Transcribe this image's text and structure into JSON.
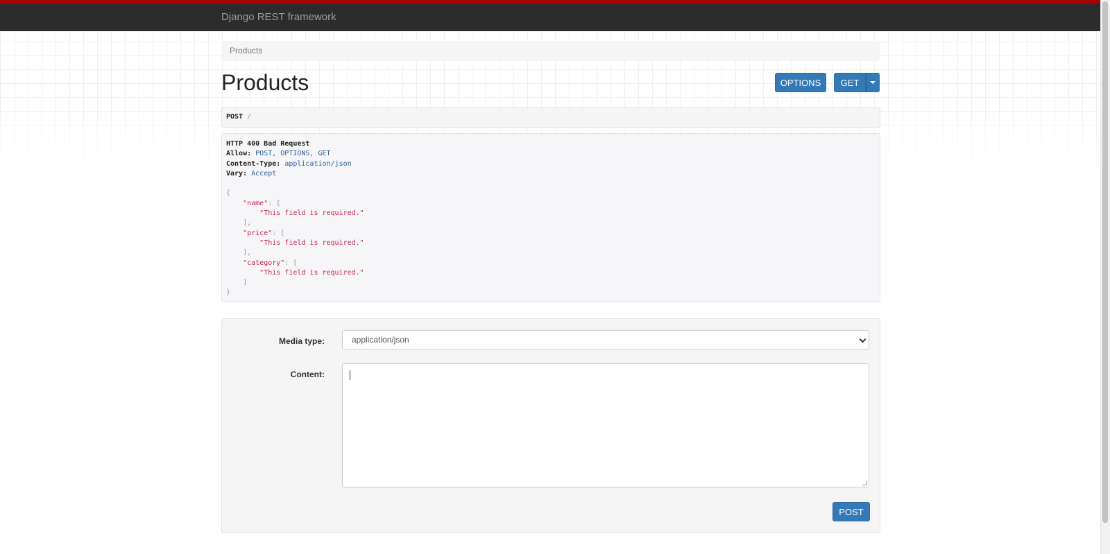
{
  "navbar": {
    "brand": "Django REST framework"
  },
  "breadcrumb": {
    "item": "Products"
  },
  "page": {
    "title": "Products"
  },
  "toolbar": {
    "options_label": "OPTIONS",
    "get_label": "GET"
  },
  "request": {
    "method": "POST",
    "path": "/"
  },
  "response": {
    "status": "HTTP 400 Bad Request",
    "headers": [
      {
        "key": "Allow:",
        "value": "POST, OPTIONS, GET"
      },
      {
        "key": "Content-Type:",
        "value": "application/json"
      },
      {
        "key": "Vary:",
        "value": "Accept"
      }
    ],
    "errors": [
      {
        "field": "\"name\"",
        "message": "\"This field is required.\""
      },
      {
        "field": "\"price\"",
        "message": "\"This field is required.\""
      },
      {
        "field": "\"category\"",
        "message": "\"This field is required.\""
      }
    ]
  },
  "form": {
    "media_type_label": "Media type:",
    "media_type_value": "application/json",
    "content_label": "Content:",
    "content_value": "",
    "submit_label": "POST"
  },
  "colors": {
    "accent": "#a30000",
    "navbar": "#2c2c2c",
    "primary": "#337ab7",
    "string": "#c7254e",
    "header_value": "#2d5f9a"
  }
}
